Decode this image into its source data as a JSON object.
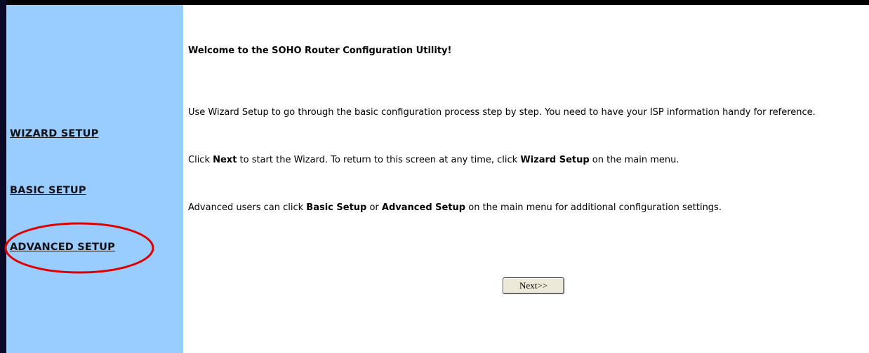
{
  "sidebar": {
    "items": [
      {
        "label": "WIZARD SETUP"
      },
      {
        "label": "BASIC SETUP"
      },
      {
        "label": "ADVANCED SETUP"
      }
    ]
  },
  "main": {
    "welcome": "Welcome to the SOHO Router Configuration Utility!",
    "para1": "Use Wizard Setup to go through the basic configuration process step by step. You need to have your ISP information handy for reference.",
    "para2": {
      "t1": "Click ",
      "b1": "Next",
      "t2": " to start the Wizard. To return to this screen at any time, click ",
      "b2": "Wizard Setup",
      "t3": " on the main menu."
    },
    "para3": {
      "t1": "Advanced users can click ",
      "b1": "Basic Setup",
      "t2": " or ",
      "b2": "Advanced Setup",
      "t3": " on the main menu for additional configuration settings."
    },
    "next_label": "Next>>"
  },
  "colors": {
    "sidebar_bg": "#99ccff",
    "highlight_ellipse": "#e00000",
    "frame_border": "#000000"
  }
}
